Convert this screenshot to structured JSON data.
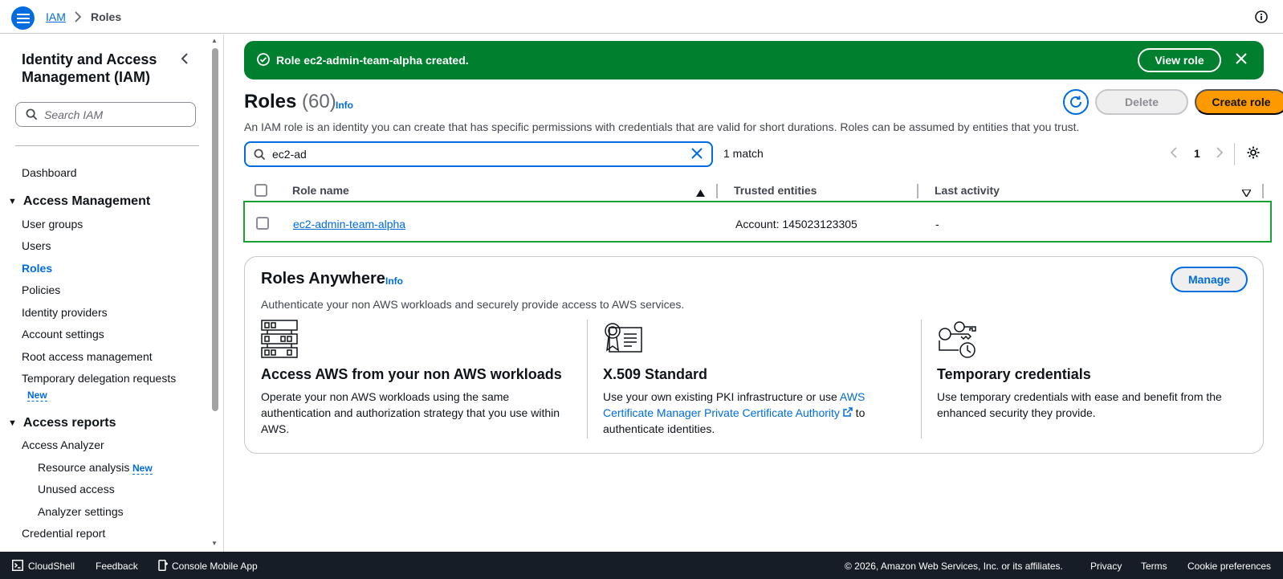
{
  "breadcrumb": {
    "service": "IAM",
    "current": "Roles"
  },
  "sidebar": {
    "title": "Identity and Access Management (IAM)",
    "search_placeholder": "Search IAM",
    "dashboard": "Dashboard",
    "sections": [
      {
        "label": "Access Management",
        "items": [
          "User groups",
          "Users",
          "Roles",
          "Policies",
          "Identity providers",
          "Account settings",
          "Root access management",
          "Temporary delegation requests"
        ]
      },
      {
        "label": "Access reports",
        "items": [
          "Access Analyzer",
          "Resource analysis",
          "Unused access",
          "Analyzer settings",
          "Credential report"
        ]
      }
    ],
    "active_item": "Roles",
    "new_badge": "New"
  },
  "flash": {
    "message": "Role ec2-admin-team-alpha created.",
    "view_role_label": "View role",
    "color": "#00802f"
  },
  "roles": {
    "title": "Roles",
    "count": "(60)",
    "info_label": "Info",
    "delete_label": "Delete",
    "create_label": "Create role",
    "description": "An IAM role is an identity you can create that has specific permissions with credentials that are valid for short durations. Roles can be assumed by entities that you trust.",
    "filter_value": "ec2-ad",
    "match_count": "1 match",
    "page": "1",
    "columns": [
      "Role name",
      "Trusted entities",
      "Last activity"
    ],
    "rows": [
      {
        "name": "ec2-admin-team-alpha",
        "trusted": "Account: 145023123305",
        "last_activity": "-"
      }
    ]
  },
  "roles_anywhere": {
    "title": "Roles Anywhere",
    "info_label": "Info",
    "manage_label": "Manage",
    "description": "Authenticate your non AWS workloads and securely provide access to AWS services.",
    "features": [
      {
        "icon": "server-rack-icon",
        "title": "Access AWS from your non AWS workloads",
        "text": "Operate your non AWS workloads using the same authentication and authorization strategy that you use within AWS."
      },
      {
        "icon": "certificate-icon",
        "title": "X.509 Standard",
        "text_before": "Use your own existing PKI infrastructure or use ",
        "link": "AWS Certificate Manager Private Certificate Authority",
        "text_after": " to authenticate identities."
      },
      {
        "icon": "keys-clock-icon",
        "title": "Temporary credentials",
        "text": "Use temporary credentials with ease and benefit from the enhanced security they provide."
      }
    ]
  },
  "footer": {
    "cloudshell": "CloudShell",
    "feedback": "Feedback",
    "mobile_app": "Console Mobile App",
    "copyright": "© 2026, Amazon Web Services, Inc. or its affiliates.",
    "privacy": "Privacy",
    "terms": "Terms",
    "cookies": "Cookie preferences"
  },
  "colors": {
    "accent": "#006ce0",
    "primary_button": "#ff9900",
    "footer_bg": "#161d26",
    "row_highlight": "#1aa135"
  }
}
